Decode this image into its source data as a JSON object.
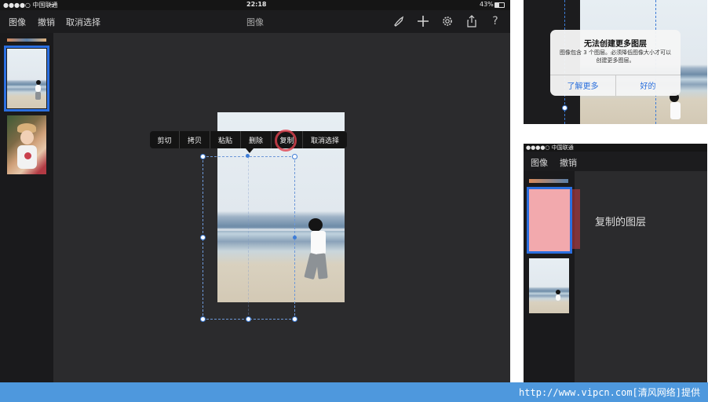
{
  "status_bar": {
    "carrier": "●●●●○ 中国联通",
    "time": "22:18",
    "battery": "43%"
  },
  "nav": {
    "image": "图像",
    "undo": "撤销",
    "deselect": "取消选择",
    "title": "图像"
  },
  "toolbar_icons": [
    "brush-icon",
    "plus-icon",
    "gear-icon",
    "share-icon",
    "help-icon"
  ],
  "context_menu": {
    "items": [
      "剪切",
      "拷贝",
      "粘贴",
      "删除",
      "复制",
      "取消选择"
    ],
    "highlighted": "复制"
  },
  "alert": {
    "title": "无法创建更多图层",
    "message": "图像包含 3 个图层。必须降低图像大小才可以创建更多图层。",
    "learn_more": "了解更多",
    "ok": "好的"
  },
  "panel2": {
    "carrier": "●●●●○ 中国联通",
    "nav": {
      "image": "图像",
      "undo": "撤销"
    },
    "caption": "复制的图层"
  },
  "watermark": "http://www.vipcn.com[清风网络]提供",
  "colors": {
    "accent": "#3d7cd6",
    "highlight_ring": "#e0424f",
    "duplicate_layer": "#f2a9ad",
    "footer": "#4e98dd"
  }
}
